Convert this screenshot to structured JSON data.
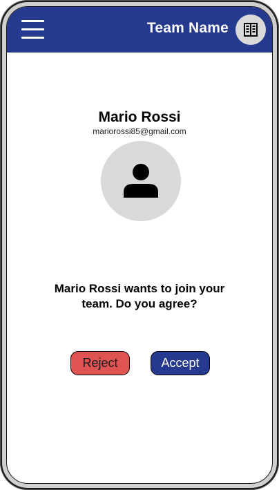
{
  "appbar": {
    "menu_icon": "hamburger-menu-icon",
    "team_name": "Team Name",
    "team_icon": "building-icon"
  },
  "user": {
    "name": "Mario Rossi",
    "email": "mariorossi85@gmail.com",
    "avatar_icon": "person-icon"
  },
  "prompt": {
    "line1": "Mario Rossi wants to join your",
    "line2": "team. Do you agree?"
  },
  "actions": {
    "reject_label": "Reject",
    "accept_label": "Accept"
  },
  "colors": {
    "primary": "#253a8e",
    "reject": "#e05353",
    "avatar_bg": "#d9d9d9"
  }
}
